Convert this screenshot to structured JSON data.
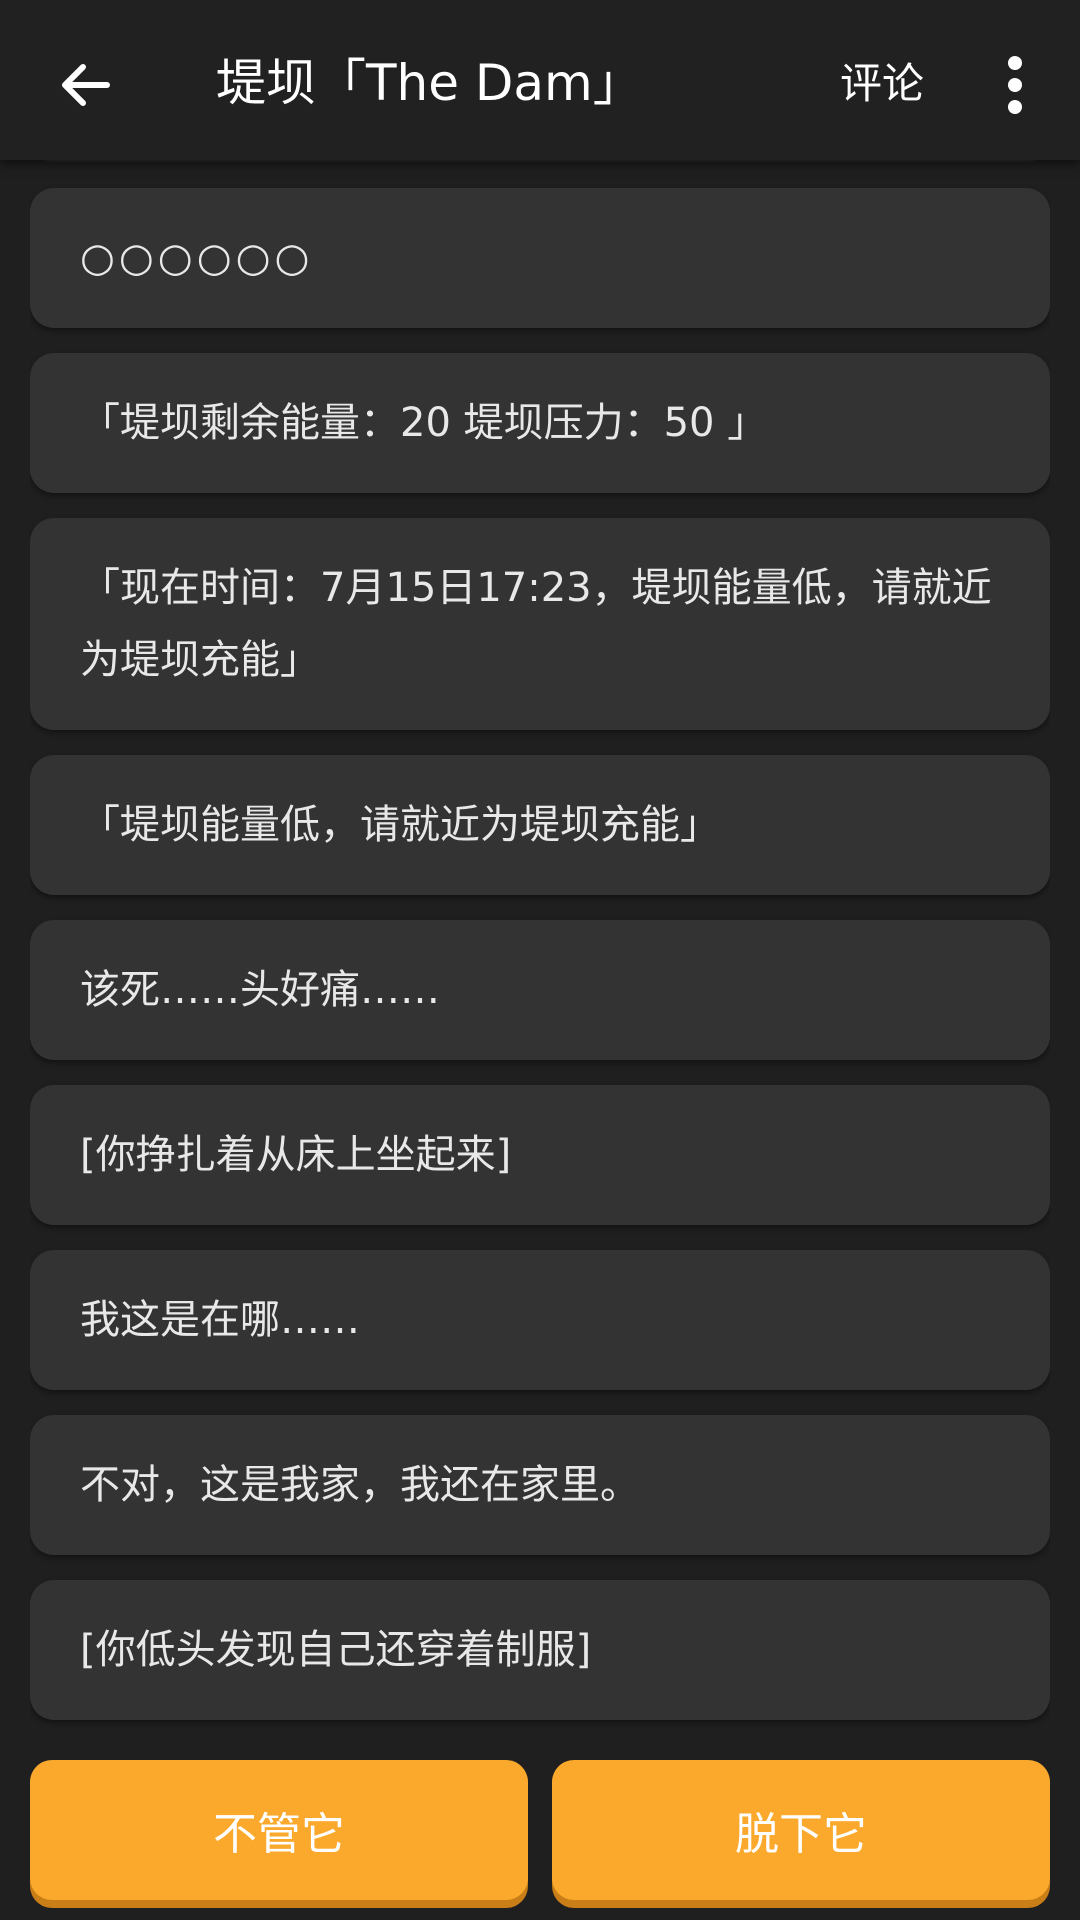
{
  "header": {
    "title": "堤坝「The Dam」",
    "comment_label": "评论",
    "back_icon": "arrow-left-icon",
    "more_icon": "more-vertical-icon"
  },
  "story": {
    "lines": [
      "○○○○○○",
      "「堤坝剩余能量：20 堤坝压力：50 」",
      "「现在时间：7月15日17:23，堤坝能量低，请就近为堤坝充能」",
      "「堤坝能量低，请就近为堤坝充能」",
      "该死……头好痛……",
      "[你挣扎着从床上坐起来]",
      "我这是在哪……",
      "不对，这是我家，我还在家里。",
      "[你低头发现自己还穿着制服]"
    ]
  },
  "choices": {
    "left_label": "不管它",
    "right_label": "脱下它"
  },
  "colors": {
    "background": "#1f1f1f",
    "card": "#333333",
    "accent": "#fba92c"
  }
}
